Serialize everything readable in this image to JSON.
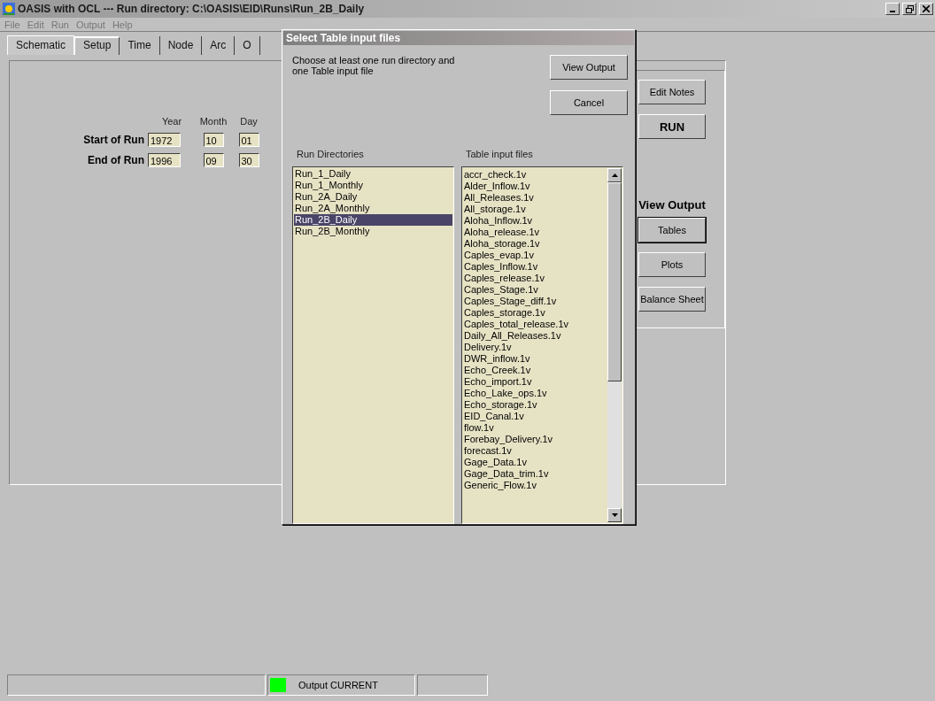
{
  "window": {
    "title": "OASIS with OCL --- Run directory: C:\\OASIS\\EID\\Runs\\Run_2B_Daily"
  },
  "menu": [
    {
      "label": "File"
    },
    {
      "label": "Edit"
    },
    {
      "label": "Run"
    },
    {
      "label": "Output"
    },
    {
      "label": "Help"
    }
  ],
  "tabs": [
    {
      "label": "Schematic",
      "selected": false
    },
    {
      "label": "Setup",
      "selected": true
    },
    {
      "label": "Time",
      "selected": false
    },
    {
      "label": "Node",
      "selected": false
    },
    {
      "label": "Arc",
      "selected": false
    },
    {
      "label": "O",
      "selected": false
    }
  ],
  "setup": {
    "columns": [
      "Year",
      "Month",
      "Day"
    ],
    "rows": [
      {
        "label": "Start of Run",
        "year": "1972",
        "month": "10",
        "day": "01"
      },
      {
        "label": "End of Run",
        "year": "1996",
        "month": "09",
        "day": "30"
      }
    ]
  },
  "actions": {
    "edit_notes": "Edit Notes",
    "run": "RUN",
    "view_output_label": "View Output",
    "buttons": [
      "Tables",
      "Plots",
      "Balance Sheet"
    ]
  },
  "dialog": {
    "title": "Select Table input files",
    "instructions": "Choose at least one run directory and one Table input file",
    "buttons": [
      "View Output",
      "Cancel"
    ],
    "run_directories": {
      "label": "Run Directories",
      "items": [
        {
          "label": "Run_1_Daily",
          "selected": false
        },
        {
          "label": "Run_1_Monthly",
          "selected": false
        },
        {
          "label": "Run_2A_Daily",
          "selected": false
        },
        {
          "label": "Run_2A_Monthly",
          "selected": false
        },
        {
          "label": "Run_2B_Daily",
          "selected": true
        },
        {
          "label": "Run_2B_Monthly",
          "selected": false
        }
      ]
    },
    "table_files": {
      "label": "Table input files",
      "items": [
        "accr_check.1v",
        "Alder_Inflow.1v",
        "All_Releases.1v",
        "All_storage.1v",
        "Aloha_Inflow.1v",
        "Aloha_release.1v",
        "Aloha_storage.1v",
        "Caples_evap.1v",
        "Caples_Inflow.1v",
        "Caples_release.1v",
        "Caples_Stage.1v",
        "Caples_Stage_diff.1v",
        "Caples_storage.1v",
        "Caples_total_release.1v",
        "Daily_All_Releases.1v",
        "Delivery.1v",
        "DWR_inflow.1v",
        "Echo_Creek.1v",
        "Echo_import.1v",
        "Echo_Lake_ops.1v",
        "Echo_storage.1v",
        "EID_Canal.1v",
        "flow.1v",
        "Forebay_Delivery.1v",
        "forecast.1v",
        "Gage_Data.1v",
        "Gage_Data_trim.1v",
        "Generic_Flow.1v"
      ]
    }
  },
  "status_bar": {
    "output_status": "Output CURRENT",
    "indicator": {
      "color": "#00ff00"
    }
  }
}
